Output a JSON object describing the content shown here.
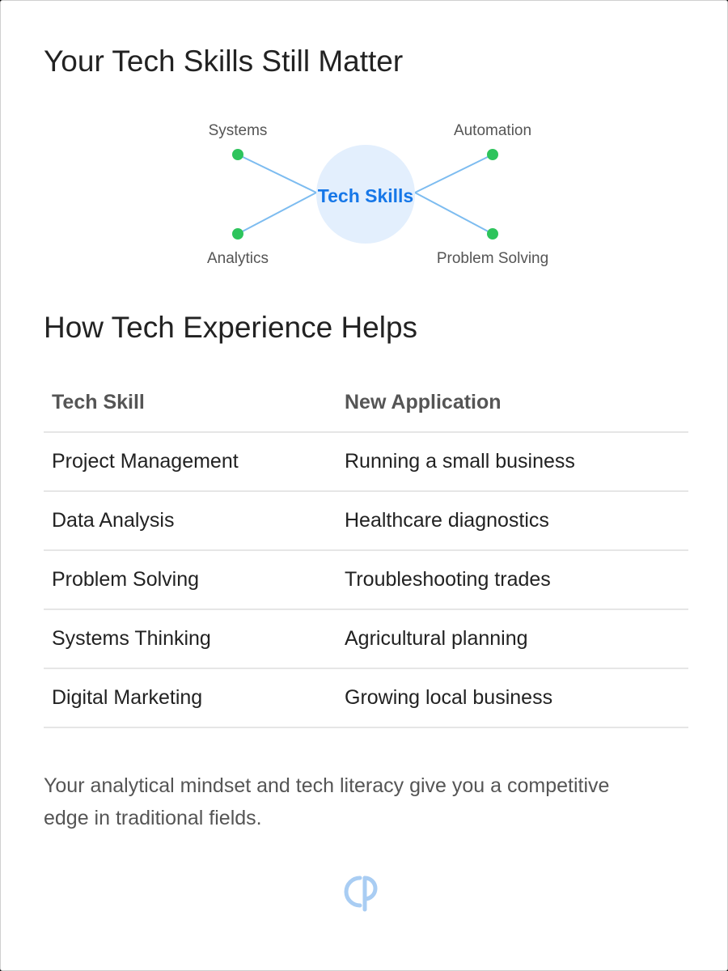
{
  "header": {
    "title": "Your Tech Skills Still Matter"
  },
  "diagram": {
    "center_label": "Tech Skills",
    "nodes": [
      {
        "label": "Systems"
      },
      {
        "label": "Automation"
      },
      {
        "label": "Analytics"
      },
      {
        "label": "Problem Solving"
      }
    ],
    "colors": {
      "node": "#2ec45c",
      "link": "#7dbcf0",
      "center_fill": "#e3effd",
      "center_text": "#1677e8"
    }
  },
  "section": {
    "title": "How Tech Experience Helps"
  },
  "table": {
    "headers": [
      "Tech Skill",
      "New Application"
    ],
    "rows": [
      [
        "Project Management",
        "Running a small business"
      ],
      [
        "Data Analysis",
        "Healthcare diagnostics"
      ],
      [
        "Problem Solving",
        "Troubleshooting trades"
      ],
      [
        "Systems Thinking",
        "Agricultural planning"
      ],
      [
        "Digital Marketing",
        "Growing local business"
      ]
    ]
  },
  "summary": {
    "text": "Your analytical mindset and tech literacy give you a competitive edge in traditional fields."
  },
  "footer": {
    "logo_icon": "cp-logo-icon"
  }
}
